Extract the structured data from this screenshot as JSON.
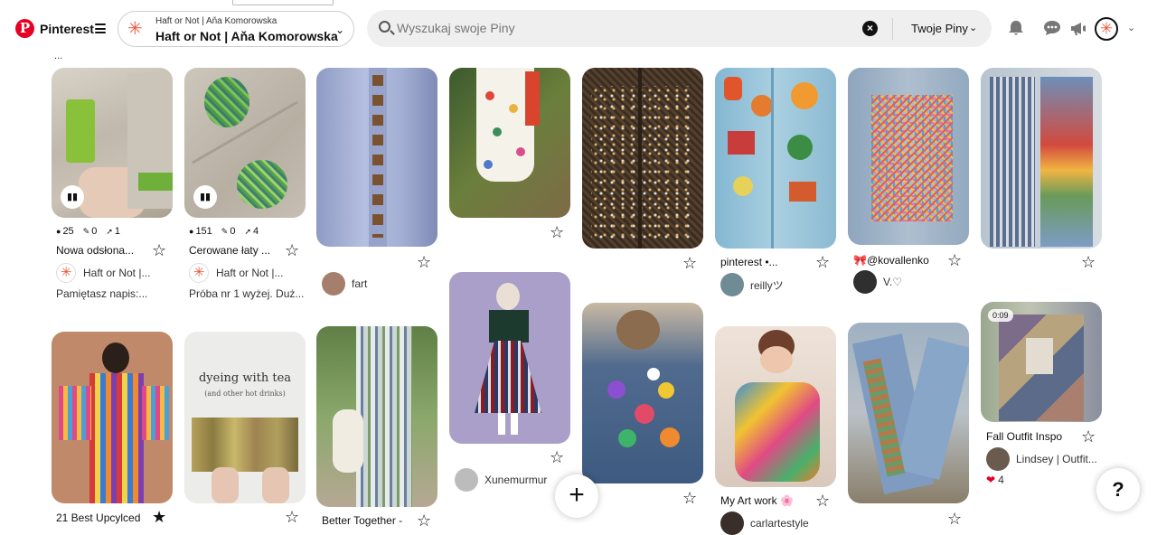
{
  "header": {
    "logo_text": "Pinterest",
    "board_switcher": {
      "small": "Haft or Not | Aňa Komorowska",
      "title": "Haft or Not | Aňa Komorowska"
    },
    "search": {
      "placeholder": "Wyszukaj swoje Piny",
      "value": "",
      "scope": "Twoje Piny"
    },
    "icons": [
      "bell-icon",
      "chat-icon",
      "megaphone-icon",
      "avatar",
      "chevron-down-icon"
    ],
    "cut_text": "..."
  },
  "pins": [
    {
      "stats": {
        "views": "25",
        "saves": "0",
        "clicks": "1"
      },
      "title": "Nowa odsłona...",
      "board": "Haft or Not |...",
      "desc": "Pamiętasz napis:..."
    },
    {
      "stats": {
        "views": "151",
        "saves": "0",
        "clicks": "4"
      },
      "title": "Cerowane łaty ...",
      "board": "Haft or Not |...",
      "desc": "Próba nr 1 wyżej. Duż..."
    },
    {
      "user": "fart"
    },
    {},
    {},
    {
      "title": "pinterest •...",
      "user": "reillyツ"
    },
    {
      "title": "🎀@kovallenko",
      "user": "V.♡"
    },
    {},
    {
      "title": "21 Best Upcylced"
    },
    {
      "image_text": "dyeing with tea",
      "image_subtext": "(and other hot drinks)"
    },
    {
      "title": "Better Together -"
    },
    {
      "user": "Xunemurmur"
    },
    {},
    {
      "title": "My Art work 🌸",
      "user": "carlartestyle"
    },
    {},
    {
      "duration": "0:09",
      "title": "Fall Outfit Inspo",
      "user": "Lindsey | Outfit...",
      "reactions": "4"
    }
  ],
  "fab": {
    "add": "+",
    "help": "?"
  },
  "colors": {
    "brand": "#e60023",
    "asterisk": "#e8593b",
    "search_bg": "#efefef"
  }
}
